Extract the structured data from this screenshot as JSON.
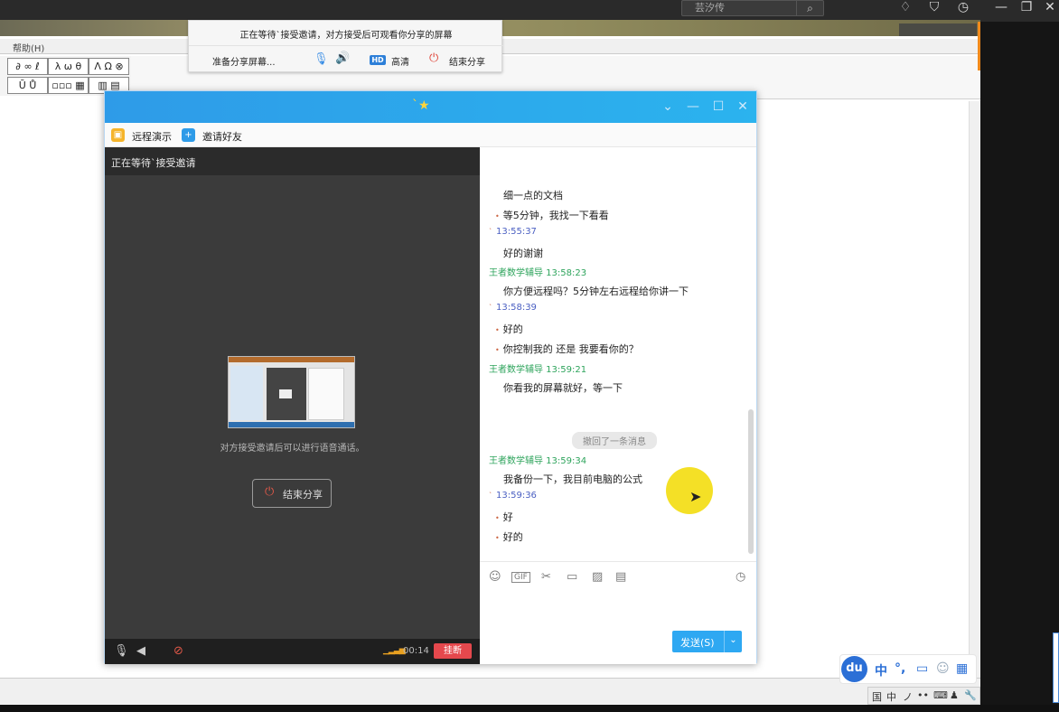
{
  "top": {
    "search_placeholder": "芸汐传"
  },
  "doc": {
    "menu_help": "帮助(H)",
    "tools": [
      "∂ ∞ ℓ",
      "λ ω θ",
      "Λ Ω ⊗",
      "Ū Ů",
      "▫▫▫ ▦",
      "▥ ▤"
    ]
  },
  "sharebar": {
    "waiting_msg": "正在等待`接受邀请，对方接受后可观看你分享的屏幕",
    "preparing": "准备分享屏幕...",
    "hd_badge": "HD",
    "hd_label": "高清",
    "end_label": "结束分享"
  },
  "chat": {
    "title_star": "`★",
    "toolbar": {
      "remote_demo": "远程演示",
      "invite_friend": "邀请好友"
    },
    "video": {
      "header": "正在等待`接受邀请",
      "note": "对方接受邀请后可以进行语音通话。",
      "end_share": "结束分享",
      "timer": "00:14",
      "hangup": "挂断"
    },
    "messages": [
      {
        "kind": "text",
        "text": "细一点的文档"
      },
      {
        "kind": "text_dot",
        "text": "等5分钟，我找一下看看"
      },
      {
        "kind": "time",
        "text": "13:55:37"
      },
      {
        "kind": "text",
        "text": "好的谢谢"
      },
      {
        "kind": "sender",
        "text": "王者数学辅导  13:58:23"
      },
      {
        "kind": "text",
        "text": "你方便远程吗？5分钟左右远程给你讲一下"
      },
      {
        "kind": "time",
        "text": "13:58:39"
      },
      {
        "kind": "text_dot",
        "text": "好的"
      },
      {
        "kind": "text_dot",
        "text": "你控制我的 还是 我要看你的？"
      },
      {
        "kind": "sender",
        "text": "王者数学辅导  13:59:21"
      },
      {
        "kind": "text",
        "text": "你看我的屏幕就好，等一下"
      },
      {
        "kind": "recall",
        "text": "撤回了一条消息"
      },
      {
        "kind": "sender",
        "text": "王者数学辅导  13:59:34"
      },
      {
        "kind": "text",
        "text": "我备份一下，我目前电脑的公式"
      },
      {
        "kind": "time",
        "text": "13:59:36"
      },
      {
        "kind": "text_dot",
        "text": "好"
      },
      {
        "kind": "text_dot",
        "text": "好的"
      }
    ],
    "send_label": "发送(S)"
  },
  "ime": {
    "logo": "du",
    "mode": "中",
    "punct": "°,",
    "extra": [
      "▭",
      "☺",
      "▦"
    ]
  },
  "tray": [
    "国",
    "中",
    "ノ",
    "••",
    "⌨",
    "♟",
    "🔧"
  ],
  "colors": {
    "title_blue": "#2e9be8",
    "send_blue": "#2ea8f2",
    "hangup_red": "#e5484d",
    "sender_green": "#2ea45c",
    "time_blue": "#4a5fc2",
    "cursor_highlight": "#f3de1a"
  }
}
